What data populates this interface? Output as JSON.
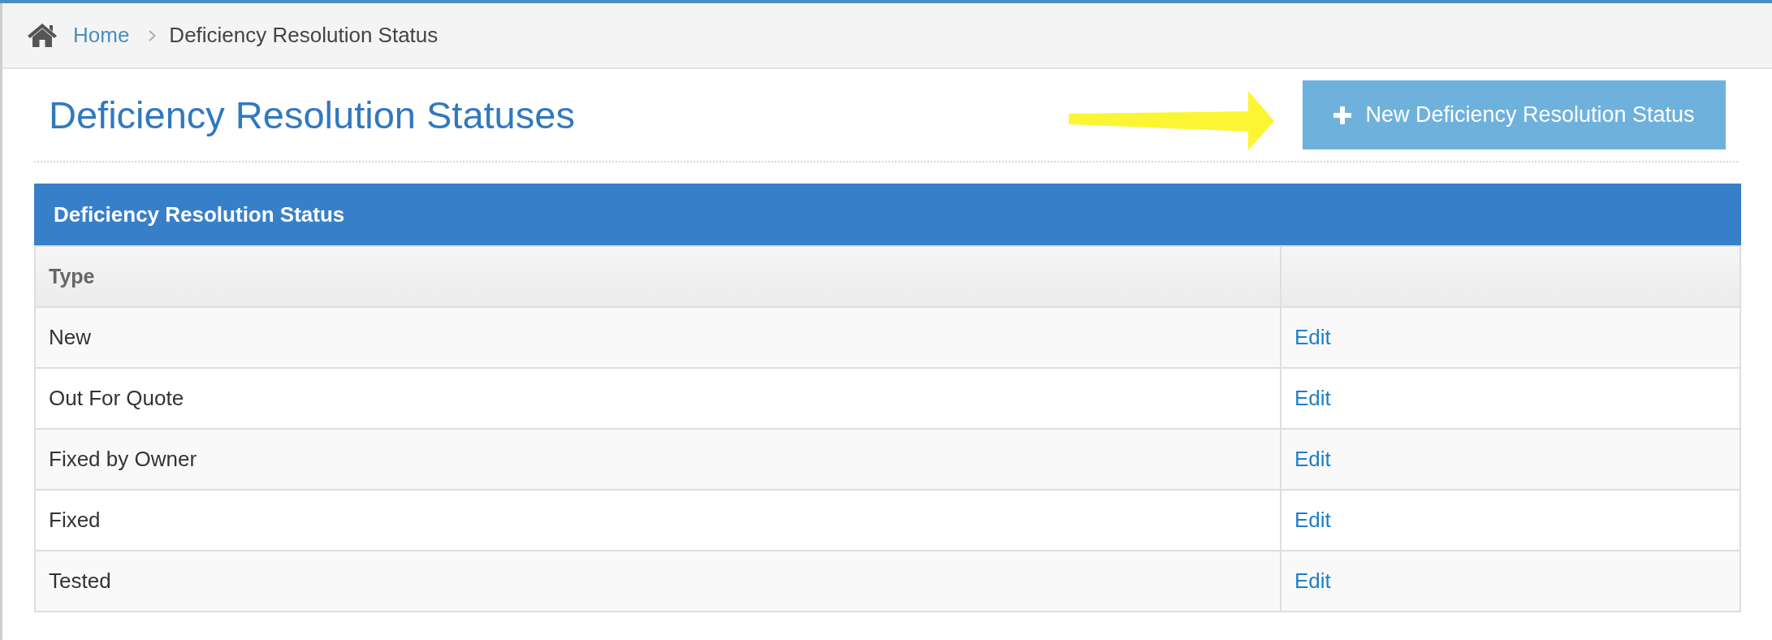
{
  "breadcrumb": {
    "items": [
      {
        "label": "Home",
        "kind": "link"
      },
      {
        "label": "Deficiency Resolution Status",
        "kind": "current"
      }
    ]
  },
  "page": {
    "title": "Deficiency Resolution Statuses",
    "new_button": "New Deficiency Resolution Status"
  },
  "panel": {
    "title": "Deficiency Resolution Status",
    "columns": [
      "Type"
    ],
    "rows": [
      {
        "type": "New",
        "action": "Edit"
      },
      {
        "type": "Out For Quote",
        "action": "Edit"
      },
      {
        "type": "Fixed by Owner",
        "action": "Edit"
      },
      {
        "type": "Fixed",
        "action": "Edit"
      },
      {
        "type": "Tested",
        "action": "Edit"
      }
    ]
  }
}
